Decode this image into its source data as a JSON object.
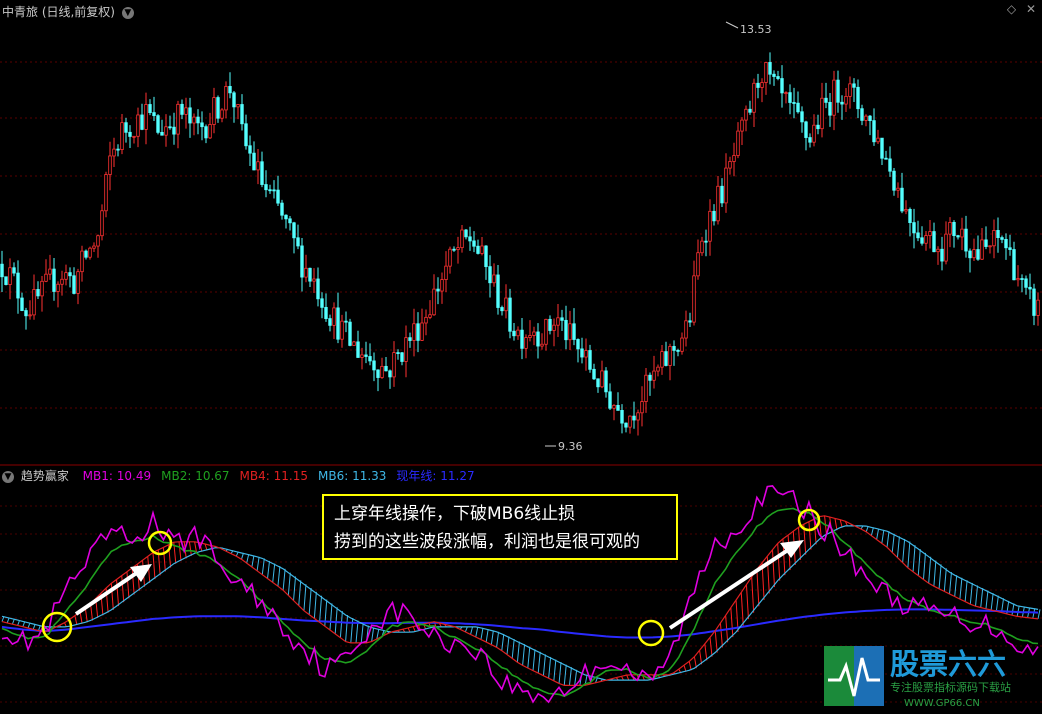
{
  "header": {
    "title": "中青旅 (日线,前复权)",
    "labels": [
      "13.53",
      "9.36"
    ]
  },
  "indicator": {
    "name": "趋势赢家",
    "legend": [
      {
        "text": "MB1: 10.49",
        "color": "#e000e0"
      },
      {
        "text": "MB2: 10.67",
        "color": "#1fa01f"
      },
      {
        "text": "MB4: 11.15",
        "color": "#e02020"
      },
      {
        "text": "MB6: 11.33",
        "color": "#3fb7e6"
      },
      {
        "text": "现年线: 11.27",
        "color": "#2a2aff"
      }
    ]
  },
  "annotation": {
    "line1": "上穿年线操作，下破MB6线止损",
    "line2": "捞到的这些波段涨幅，利润也是很可观的"
  },
  "watermark": {
    "main": "股票六六",
    "sub": "专注股票指标源码下载站",
    "url": "WWW.GP66.CN"
  },
  "colors": {
    "up": "#ff3232",
    "down": "#54ffff",
    "grid": "#7a0000",
    "highlight": "#ffff00"
  },
  "chart_data": [
    {
      "type": "candlestick",
      "title": "中青旅 (日线,前复权)",
      "ylim": [
        9.0,
        14.0
      ],
      "annotations": [
        {
          "text": "13.53",
          "value": 13.53
        },
        {
          "text": "9.36",
          "value": 9.36
        }
      ],
      "close": [
        11.2,
        11.0,
        10.7,
        10.8,
        11.0,
        11.1,
        11.0,
        11.3,
        11.5,
        12.4,
        12.7,
        12.8,
        12.9,
        12.7,
        12.8,
        12.9,
        12.7,
        12.8,
        13.0,
        13.2,
        12.6,
        12.3,
        12.0,
        11.8,
        11.5,
        11.2,
        11.0,
        10.7,
        10.5,
        10.3,
        10.2,
        10.1,
        10.0,
        10.2,
        10.4,
        10.6,
        10.9,
        11.2,
        11.4,
        11.5,
        11.2,
        10.9,
        10.6,
        10.4,
        10.5,
        10.4,
        10.6,
        10.4,
        10.2,
        10.0,
        9.8,
        9.6,
        9.5,
        9.7,
        9.9,
        10.1,
        10.3,
        10.5,
        11.5,
        11.8,
        12.1,
        12.5,
        12.9,
        13.4,
        13.2,
        13.0,
        12.8,
        12.6,
        12.9,
        13.1,
        13.2,
        13.0,
        12.8,
        12.5,
        12.2,
        11.8,
        11.6,
        11.5,
        11.4,
        11.6,
        11.5,
        11.3,
        11.4,
        11.5,
        11.2,
        10.8,
        10.7
      ]
    },
    {
      "type": "line",
      "name": "趋势赢家",
      "series": [
        {
          "name": "MB1",
          "last": 10.49,
          "values": [
            11.0,
            10.7,
            10.9,
            11.7,
            12.2,
            12.8,
            12.6,
            13.0,
            12.5,
            12.8,
            12.2,
            11.8,
            11.5,
            11.0,
            10.6,
            10.2,
            10.4,
            11.0,
            11.3,
            11.2,
            10.8,
            10.7,
            10.6,
            10.0,
            9.8,
            9.7,
            9.8,
            10.1,
            10.4,
            10.2,
            9.9,
            10.5,
            11.6,
            12.6,
            12.8,
            13.4,
            13.5,
            13.3,
            12.9,
            12.4,
            12.0,
            11.6,
            11.4,
            11.3,
            11.2,
            11.1,
            11.0,
            10.7,
            10.5
          ]
        },
        {
          "name": "MB2",
          "last": 10.67,
          "values": [
            11.0,
            10.8,
            10.8,
            11.3,
            11.8,
            12.4,
            12.6,
            12.7,
            12.5,
            12.4,
            12.2,
            11.9,
            11.5,
            11.1,
            10.7,
            10.4,
            10.3,
            10.6,
            11.0,
            11.1,
            11.0,
            10.8,
            10.6,
            10.3,
            10.0,
            9.8,
            9.7,
            9.9,
            10.2,
            10.2,
            10.0,
            10.2,
            10.9,
            11.8,
            12.4,
            12.9,
            13.2,
            13.2,
            13.0,
            12.6,
            12.2,
            11.8,
            11.5,
            11.3,
            11.2,
            11.1,
            11.0,
            10.8,
            10.67
          ]
        },
        {
          "name": "MB4",
          "last": 11.15,
          "values": [
            11.1,
            11.0,
            10.9,
            11.1,
            11.4,
            11.8,
            12.1,
            12.4,
            12.6,
            12.6,
            12.5,
            12.3,
            12.0,
            11.7,
            11.3,
            11.0,
            10.7,
            10.7,
            10.9,
            11.0,
            11.1,
            11.0,
            10.8,
            10.6,
            10.3,
            10.1,
            9.9,
            9.9,
            10.0,
            10.1,
            10.1,
            10.1,
            10.4,
            10.9,
            11.5,
            12.1,
            12.6,
            12.9,
            13.1,
            13.0,
            12.8,
            12.5,
            12.1,
            11.8,
            11.6,
            11.4,
            11.3,
            11.2,
            11.15
          ]
        },
        {
          "name": "MB6",
          "last": 11.33,
          "values": [
            11.2,
            11.1,
            11.0,
            11.0,
            11.1,
            11.3,
            11.6,
            11.9,
            12.2,
            12.4,
            12.5,
            12.4,
            12.3,
            12.1,
            11.8,
            11.5,
            11.2,
            11.0,
            10.9,
            10.9,
            11.0,
            11.0,
            11.0,
            10.9,
            10.7,
            10.5,
            10.3,
            10.1,
            10.0,
            10.0,
            10.0,
            10.1,
            10.2,
            10.5,
            10.9,
            11.4,
            11.9,
            12.3,
            12.7,
            12.9,
            12.9,
            12.8,
            12.6,
            12.3,
            12.0,
            11.8,
            11.6,
            11.4,
            11.33
          ]
        },
        {
          "name": "现年线",
          "last": 11.27,
          "values": [
            11.0,
            10.95,
            10.92,
            10.95,
            11.0,
            11.05,
            11.1,
            11.15,
            11.18,
            11.2,
            11.2,
            11.2,
            11.18,
            11.15,
            11.12,
            11.1,
            11.08,
            11.07,
            11.07,
            11.08,
            11.08,
            11.07,
            11.05,
            11.02,
            10.98,
            10.95,
            10.9,
            10.86,
            10.82,
            10.8,
            10.8,
            10.82,
            10.86,
            10.92,
            10.98,
            11.05,
            11.12,
            11.18,
            11.23,
            11.27,
            11.3,
            11.32,
            11.33,
            11.33,
            11.32,
            11.31,
            11.3,
            11.28,
            11.27
          ]
        }
      ]
    }
  ]
}
